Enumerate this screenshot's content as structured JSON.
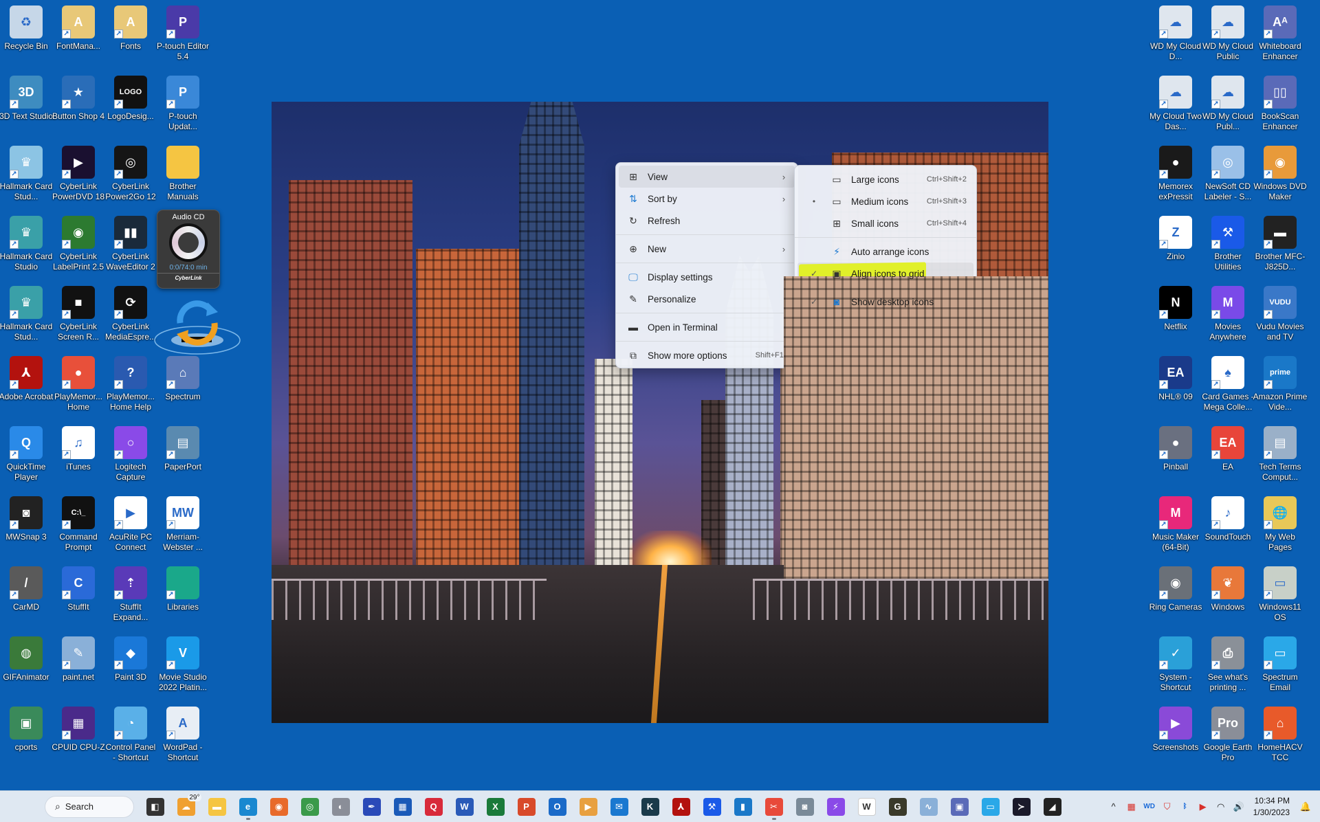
{
  "desktop": {
    "left_icons": [
      {
        "label": "Recycle Bin",
        "icon": "recycle-bin-icon",
        "color": "#c6d7e8",
        "glyph": "♻",
        "shortcut": false
      },
      {
        "label": "FontMana...",
        "icon": "font-manager-icon",
        "color": "#e8c878",
        "glyph": "A",
        "shortcut": true
      },
      {
        "label": "Fonts",
        "icon": "fonts-folder-icon",
        "color": "#e8c878",
        "glyph": "A",
        "shortcut": true
      },
      {
        "label": "P-touch Editor 5.4",
        "icon": "p-touch-editor-icon",
        "color": "#4a3aa8",
        "glyph": "P",
        "shortcut": true
      },
      {
        "label": "3D Text Studio",
        "icon": "3d-text-studio-icon",
        "color": "#3e8cc0",
        "glyph": "3D",
        "shortcut": true
      },
      {
        "label": "Button Shop 4",
        "icon": "button-shop-icon",
        "color": "#2a6db8",
        "glyph": "★",
        "shortcut": true
      },
      {
        "label": "LogoDesig...",
        "icon": "logo-design-icon",
        "color": "#111111",
        "glyph": "LOGO",
        "shortcut": true
      },
      {
        "label": "P-touch Updat...",
        "icon": "p-touch-update-icon",
        "color": "#3a88d8",
        "glyph": "P",
        "shortcut": true
      },
      {
        "label": "Hallmark Card Stud...",
        "icon": "hallmark-crown-icon",
        "color": "#8cc4e4",
        "glyph": "♛",
        "shortcut": true
      },
      {
        "label": "CyberLink PowerDVD 18",
        "icon": "powerdvd-icon",
        "color": "#1a1030",
        "glyph": "▶",
        "shortcut": true
      },
      {
        "label": "CyberLink Power2Go 12",
        "icon": "power2go-icon",
        "color": "#151515",
        "glyph": "◎",
        "shortcut": true
      },
      {
        "label": "Brother Manuals",
        "icon": "folder-icon",
        "color": "#f5c542",
        "glyph": "",
        "shortcut": false
      },
      {
        "label": "Hallmark Card Studio",
        "icon": "hallmark-crown-icon",
        "color": "#3aa0a8",
        "glyph": "♛",
        "shortcut": true
      },
      {
        "label": "CyberLink LabelPrint 2.5",
        "icon": "labelprint-icon",
        "color": "#2c7a30",
        "glyph": "◉",
        "shortcut": true
      },
      {
        "label": "CyberLink WaveEditor 2",
        "icon": "waveeditor-icon",
        "color": "#1a2a3a",
        "glyph": "▮▮",
        "shortcut": true
      },
      {
        "label": "Hallmark Card Stud...",
        "icon": "hallmark-crown-icon",
        "color": "#3aa0a8",
        "glyph": "♛",
        "shortcut": true
      },
      {
        "label": "CyberLink Screen R...",
        "icon": "screen-recorder-icon",
        "color": "#111111",
        "glyph": "■",
        "shortcut": true
      },
      {
        "label": "CyberLink MediaEspre...",
        "icon": "mediaespresso-icon",
        "color": "#111111",
        "glyph": "⟳",
        "shortcut": true
      },
      {
        "label": "Adobe Acrobat",
        "icon": "adobe-acrobat-icon",
        "color": "#b3120e",
        "glyph": "⅄",
        "shortcut": true
      },
      {
        "label": "PlayMemor... Home",
        "icon": "playmemories-icon",
        "color": "#e8503a",
        "glyph": "●",
        "shortcut": true
      },
      {
        "label": "PlayMemor... Home Help",
        "icon": "help-icon",
        "color": "#2a5ab0",
        "glyph": "?",
        "shortcut": true
      },
      {
        "label": "Spectrum",
        "icon": "spectrum-house-icon",
        "color": "#5a7ab8",
        "glyph": "⌂",
        "shortcut": true
      },
      {
        "label": "QuickTime Player",
        "icon": "quicktime-icon",
        "color": "#2a8ae8",
        "glyph": "Q",
        "shortcut": true
      },
      {
        "label": "iTunes",
        "icon": "itunes-icon",
        "color": "#ffffff",
        "glyph": "♫",
        "shortcut": true
      },
      {
        "label": "Logitech Capture",
        "icon": "logitech-capture-icon",
        "color": "#8a4ae8",
        "glyph": "○",
        "shortcut": true
      },
      {
        "label": "PaperPort",
        "icon": "paperport-icon",
        "color": "#5a8ab0",
        "glyph": "▤",
        "shortcut": true
      },
      {
        "label": "MWSnap 3",
        "icon": "camera-icon",
        "color": "#222222",
        "glyph": "◙",
        "shortcut": true
      },
      {
        "label": "Command Prompt",
        "icon": "command-prompt-icon",
        "color": "#111111",
        "glyph": "C:\\_",
        "shortcut": true
      },
      {
        "label": "AcuRite PC Connect",
        "icon": "acurite-icon",
        "color": "#ffffff",
        "glyph": "▶",
        "shortcut": true
      },
      {
        "label": "Merriam-Webster ...",
        "icon": "merriam-webster-icon",
        "color": "#ffffff",
        "glyph": "MW",
        "shortcut": true
      },
      {
        "label": "CarMD",
        "icon": "carmd-icon",
        "color": "#5a5a5a",
        "glyph": "/",
        "shortcut": true
      },
      {
        "label": "StuffIt",
        "icon": "stuffit-icon",
        "color": "#2a6ad8",
        "glyph": "C",
        "shortcut": true
      },
      {
        "label": "StuffIt Expand...",
        "icon": "stuffit-expander-icon",
        "color": "#5a3ab8",
        "glyph": "⇡",
        "shortcut": true
      },
      {
        "label": "Libraries",
        "icon": "libraries-folder-icon",
        "color": "#1aa88a",
        "glyph": "",
        "shortcut": true
      },
      {
        "label": "GIFAnimator",
        "icon": "gif-animator-icon",
        "color": "#3a7a3a",
        "glyph": "◍",
        "shortcut": false
      },
      {
        "label": "paint.net",
        "icon": "paint-net-icon",
        "color": "#8ab0d8",
        "glyph": "✎",
        "shortcut": true
      },
      {
        "label": "Paint 3D",
        "icon": "paint-3d-icon",
        "color": "#1a78d8",
        "glyph": "◆",
        "shortcut": true
      },
      {
        "label": "Movie Studio 2022 Platin...",
        "icon": "movie-studio-icon",
        "color": "#1a9ae8",
        "glyph": "V",
        "shortcut": true
      },
      {
        "label": "cports",
        "icon": "cports-icon",
        "color": "#3a8a5a",
        "glyph": "▣",
        "shortcut": false
      },
      {
        "label": "CPUID CPU-Z",
        "icon": "cpu-z-icon",
        "color": "#4a2a8a",
        "glyph": "▦",
        "shortcut": true
      },
      {
        "label": "Control Panel - Shortcut",
        "icon": "control-panel-icon",
        "color": "#5ab0e8",
        "glyph": "◔",
        "shortcut": true
      },
      {
        "label": "WordPad - Shortcut",
        "icon": "wordpad-icon",
        "color": "#e8eef5",
        "glyph": "A",
        "shortcut": true
      }
    ],
    "right_icons": [
      {
        "label": "WD My Cloud D...",
        "icon": "wd-cloud-icon",
        "color": "#dfe6ee",
        "glyph": "☁",
        "shortcut": true
      },
      {
        "label": "WD My Cloud Public",
        "icon": "wd-cloud-icon",
        "color": "#dfe6ee",
        "glyph": "☁",
        "shortcut": true
      },
      {
        "label": "Whiteboard Enhancer",
        "icon": "whiteboard-enhancer-icon",
        "color": "#5a6ab8",
        "glyph": "Aᴬ",
        "shortcut": true
      },
      {
        "label": "My Cloud Two Das...",
        "icon": "wd-cloud-icon",
        "color": "#dfe6ee",
        "glyph": "☁",
        "shortcut": true
      },
      {
        "label": "WD My Cloud Publ...",
        "icon": "wd-cloud-icon",
        "color": "#dfe6ee",
        "glyph": "☁",
        "shortcut": true
      },
      {
        "label": "BookScan Enhancer",
        "icon": "bookscan-enhancer-icon",
        "color": "#5a6ab8",
        "glyph": "▯▯",
        "shortcut": true
      },
      {
        "label": "Memorex exPressit",
        "icon": "memorex-icon",
        "color": "#1a1a1a",
        "glyph": "●",
        "shortcut": true
      },
      {
        "label": "NewSoft CD Labeler - S...",
        "icon": "cd-labeler-icon",
        "color": "#9ac0e8",
        "glyph": "◎",
        "shortcut": true
      },
      {
        "label": "Windows DVD Maker",
        "icon": "dvd-maker-icon",
        "color": "#e89a3a",
        "glyph": "◉",
        "shortcut": true
      },
      {
        "label": "Zinio",
        "icon": "zinio-icon",
        "color": "#ffffff",
        "glyph": "Z",
        "shortcut": true
      },
      {
        "label": "Brother Utilities",
        "icon": "brother-utilities-icon",
        "color": "#1a5ae8",
        "glyph": "⚒",
        "shortcut": true
      },
      {
        "label": "Brother MFC-J825D...",
        "icon": "printer-icon",
        "color": "#222222",
        "glyph": "▬",
        "shortcut": true
      },
      {
        "label": "Netflix",
        "icon": "netflix-icon",
        "color": "#000000",
        "glyph": "N",
        "shortcut": true
      },
      {
        "label": "Movies Anywhere",
        "icon": "movies-anywhere-icon",
        "color": "#7a4ae8",
        "glyph": "M",
        "shortcut": true
      },
      {
        "label": "Vudu Movies and TV",
        "icon": "vudu-icon",
        "color": "#3a78c8",
        "glyph": "VUDU",
        "shortcut": true
      },
      {
        "label": "NHL® 09",
        "icon": "nhl-icon",
        "color": "#1a3a8a",
        "glyph": "EA",
        "shortcut": true
      },
      {
        "label": "Card Games - Mega Colle...",
        "icon": "card-games-icon",
        "color": "#ffffff",
        "glyph": "♠",
        "shortcut": true
      },
      {
        "label": "Amazon Prime Vide...",
        "icon": "prime-video-icon",
        "color": "#1a78c8",
        "glyph": "prime",
        "shortcut": true
      },
      {
        "label": "Pinball",
        "icon": "pinball-icon",
        "color": "#6a7080",
        "glyph": "●",
        "shortcut": true
      },
      {
        "label": "EA",
        "icon": "ea-icon",
        "color": "#e8453a",
        "glyph": "EA",
        "shortcut": true
      },
      {
        "label": "Tech Terms Comput...",
        "icon": "tech-terms-icon",
        "color": "#9ab0c8",
        "glyph": "▤",
        "shortcut": true
      },
      {
        "label": "Music Maker (64-Bit)",
        "icon": "music-maker-icon",
        "color": "#e8287a",
        "glyph": "M",
        "shortcut": true
      },
      {
        "label": "SoundTouch",
        "icon": "soundtouch-icon",
        "color": "#ffffff",
        "glyph": "♪",
        "shortcut": true
      },
      {
        "label": "My Web Pages",
        "icon": "my-web-pages-icon",
        "color": "#e8c858",
        "glyph": "🌐",
        "shortcut": true
      },
      {
        "label": "Ring Cameras",
        "icon": "ring-camera-icon",
        "color": "#6a7078",
        "glyph": "◉",
        "shortcut": true
      },
      {
        "label": "Windows",
        "icon": "msn-butterfly-icon",
        "color": "#e8783a",
        "glyph": "❦",
        "shortcut": true
      },
      {
        "label": "Windows11 OS",
        "icon": "old-computer-icon",
        "color": "#c8d0c8",
        "glyph": "▭",
        "shortcut": true
      },
      {
        "label": "System - Shortcut",
        "icon": "system-monitor-icon",
        "color": "#2aa0d8",
        "glyph": "✓",
        "shortcut": true
      },
      {
        "label": "See what's printing ...",
        "icon": "print-queue-icon",
        "color": "#8a9098",
        "glyph": "⎙",
        "shortcut": true
      },
      {
        "label": "Spectrum Email",
        "icon": "spectrum-email-icon",
        "color": "#2aa8e8",
        "glyph": "▭",
        "shortcut": true
      },
      {
        "label": "Screenshots",
        "icon": "screenshots-folder-icon",
        "color": "#8a4ad8",
        "glyph": "▶",
        "shortcut": true
      },
      {
        "label": "Google Earth Pro",
        "icon": "google-earth-pro-icon",
        "color": "#8a8e98",
        "glyph": "Pro",
        "shortcut": true
      },
      {
        "label": "HomeHACV TCC",
        "icon": "home-network-icon",
        "color": "#e85a2a",
        "glyph": "⌂",
        "shortcut": true
      }
    ],
    "audio_cd_widget": {
      "title": "Audio CD",
      "time": "0:0/74:0 min",
      "brand": "CyberLink"
    }
  },
  "context_menu": {
    "items": [
      {
        "label": "View",
        "icon": "view-grid-icon",
        "glyph": "⊞",
        "has_submenu": true,
        "hover": true
      },
      {
        "label": "Sort by",
        "icon": "sort-icon",
        "glyph": "⇅",
        "has_submenu": true
      },
      {
        "label": "Refresh",
        "icon": "refresh-icon",
        "glyph": "↻",
        "has_submenu": false
      },
      {
        "separator": true
      },
      {
        "label": "New",
        "icon": "new-plus-icon",
        "glyph": "⊕",
        "has_submenu": true
      },
      {
        "separator": true
      },
      {
        "label": "Display settings",
        "icon": "display-settings-icon",
        "glyph": "🖵",
        "has_submenu": false
      },
      {
        "label": "Personalize",
        "icon": "personalize-brush-icon",
        "glyph": "✎",
        "has_submenu": false
      },
      {
        "separator": true
      },
      {
        "label": "Open in Terminal",
        "icon": "terminal-icon",
        "glyph": "▬",
        "has_submenu": false
      },
      {
        "separator": true
      },
      {
        "label": "Show more options",
        "icon": "more-options-icon",
        "glyph": "⧉",
        "shortcut": "Shift+F10"
      }
    ]
  },
  "view_submenu": {
    "items": [
      {
        "label": "Large icons",
        "icon": "large-icons-icon",
        "glyph": "▭",
        "shortcut": "Ctrl+Shift+2",
        "mark": ""
      },
      {
        "label": "Medium icons",
        "icon": "medium-icons-icon",
        "glyph": "▭",
        "shortcut": "Ctrl+Shift+3",
        "mark": "•"
      },
      {
        "label": "Small icons",
        "icon": "small-icons-icon",
        "glyph": "⊞",
        "shortcut": "Ctrl+Shift+4",
        "mark": ""
      },
      {
        "separator": true
      },
      {
        "label": "Auto arrange icons",
        "icon": "auto-arrange-icon",
        "glyph": "⚡",
        "shortcut": "",
        "mark": ""
      },
      {
        "label": "Align icons to grid",
        "icon": "align-grid-icon",
        "glyph": "▣",
        "shortcut": "",
        "mark": "✓",
        "highlighted": true
      },
      {
        "separator": true
      },
      {
        "label": "Show desktop icons",
        "icon": "show-desktop-icons-icon",
        "glyph": "◙",
        "shortcut": "",
        "mark": "✓"
      }
    ],
    "highlight_color": "#e1f02a"
  },
  "taskbar": {
    "search_label": "Search",
    "weather_temp": "29°",
    "apps": [
      {
        "name": "task-view",
        "icon": "task-view-icon",
        "color": "#333333",
        "glyph": "◧"
      },
      {
        "name": "weather",
        "icon": "weather-icon",
        "color": "#f0a030",
        "glyph": "☁"
      },
      {
        "name": "file-explorer",
        "icon": "file-explorer-icon",
        "color": "#f5c542",
        "glyph": "▬"
      },
      {
        "name": "edge",
        "icon": "edge-icon",
        "color": "#1a88d0",
        "glyph": "e",
        "running": true
      },
      {
        "name": "firefox",
        "icon": "firefox-icon",
        "color": "#e86a2a",
        "glyph": "◉"
      },
      {
        "name": "chrome",
        "icon": "chrome-icon",
        "color": "#3a9a4a",
        "glyph": "◎"
      },
      {
        "name": "google-earth-pro",
        "icon": "google-earth-pro-icon",
        "color": "#8a8e98",
        "glyph": "◐"
      },
      {
        "name": "app-feather",
        "icon": "feather-app-icon",
        "color": "#2a4ab8",
        "glyph": "✒"
      },
      {
        "name": "microsoft-store",
        "icon": "store-icon",
        "color": "#1a5ab8",
        "glyph": "▦"
      },
      {
        "name": "quicken",
        "icon": "quicken-icon",
        "color": "#d82a3a",
        "glyph": "Q"
      },
      {
        "name": "word",
        "icon": "word-icon",
        "color": "#2a5ab8",
        "glyph": "W"
      },
      {
        "name": "excel",
        "icon": "excel-icon",
        "color": "#1a7a3a",
        "glyph": "X"
      },
      {
        "name": "powerpoint",
        "icon": "powerpoint-icon",
        "color": "#d84a2a",
        "glyph": "P"
      },
      {
        "name": "outlook",
        "icon": "outlook-icon",
        "color": "#1a6ac8",
        "glyph": "O"
      },
      {
        "name": "media-player",
        "icon": "media-player-icon",
        "color": "#e8a040",
        "glyph": "▶"
      },
      {
        "name": "mail",
        "icon": "mail-icon",
        "color": "#1a78d0",
        "glyph": "✉"
      },
      {
        "name": "k-app",
        "icon": "k-app-icon",
        "color": "#1a3a4a",
        "glyph": "K"
      },
      {
        "name": "adobe-acrobat",
        "icon": "adobe-acrobat-icon",
        "color": "#b3120e",
        "glyph": "⅄"
      },
      {
        "name": "brother-utilities",
        "icon": "brother-utilities-icon",
        "color": "#1a5ae8",
        "glyph": "⚒"
      },
      {
        "name": "phone-link",
        "icon": "phone-link-icon",
        "color": "#1a78c8",
        "glyph": "▮"
      },
      {
        "name": "snipping-tool",
        "icon": "snipping-tool-icon",
        "color": "#e84a3a",
        "glyph": "✂",
        "running": true
      },
      {
        "name": "screen-recorder",
        "icon": "screen-recorder-icon",
        "color": "#7a8a98",
        "glyph": "◙"
      },
      {
        "name": "messenger",
        "icon": "messenger-icon",
        "color": "#8a4ae8",
        "glyph": "⚡"
      },
      {
        "name": "wikipedia",
        "icon": "wikipedia-icon",
        "color": "#ffffff",
        "glyph": "W"
      },
      {
        "name": "g-app",
        "icon": "g-app-icon",
        "color": "#3a3a2a",
        "glyph": "G"
      },
      {
        "name": "resource-monitor",
        "icon": "resource-monitor-icon",
        "color": "#8ab0d8",
        "glyph": "∿"
      },
      {
        "name": "system-info",
        "icon": "system-info-icon",
        "color": "#5a6ab8",
        "glyph": "▣"
      },
      {
        "name": "spectrum-email",
        "icon": "spectrum-email-icon",
        "color": "#2aa8e8",
        "glyph": "▭"
      },
      {
        "name": "powershell",
        "icon": "powershell-icon",
        "color": "#1a1a2a",
        "glyph": "≻"
      },
      {
        "name": "sticky-notes",
        "icon": "sticky-notes-icon",
        "color": "#222222",
        "glyph": "◢"
      }
    ],
    "tray": [
      {
        "icon": "show-hidden-chevron-icon",
        "glyph": "^"
      },
      {
        "icon": "cpu-temp-icon",
        "glyph": "▦"
      },
      {
        "icon": "wd-tray-icon",
        "glyph": "WD"
      },
      {
        "icon": "mcafee-icon",
        "glyph": "⛉"
      },
      {
        "icon": "bluetooth-icon",
        "glyph": "ᛒ"
      },
      {
        "icon": "media-play-tray-icon",
        "glyph": "▶"
      },
      {
        "icon": "wifi-icon",
        "glyph": "◠"
      },
      {
        "icon": "volume-icon",
        "glyph": "🔊"
      }
    ],
    "time": "10:34 PM",
    "date": "1/30/2023",
    "notification_icon": "notification-bell-icon"
  }
}
